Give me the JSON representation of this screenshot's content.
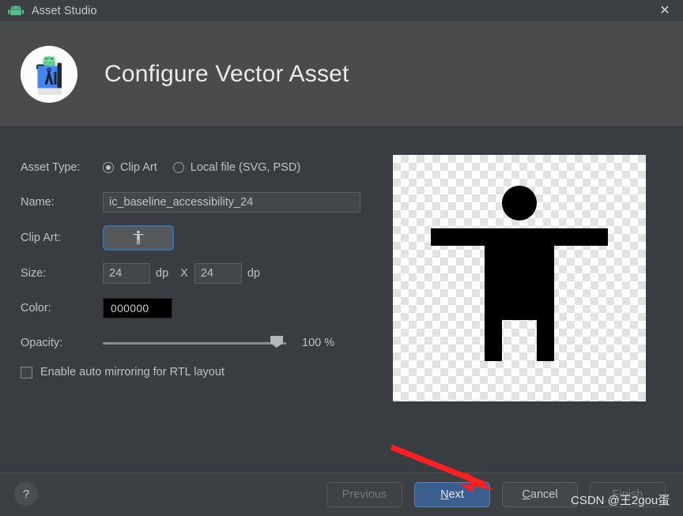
{
  "window": {
    "title": "Asset Studio",
    "app_icon": "android-robot-icon",
    "close_label": "✕"
  },
  "header": {
    "logo": "asset-studio-logo-icon",
    "title": "Configure Vector Asset"
  },
  "form": {
    "asset_type": {
      "label": "Asset Type:",
      "options": [
        {
          "label": "Clip Art",
          "selected": true
        },
        {
          "label": "Local file (SVG, PSD)",
          "selected": false
        }
      ]
    },
    "name": {
      "label": "Name:",
      "value": "ic_baseline_accessibility_24",
      "placeholder": ""
    },
    "clip_art": {
      "label": "Clip Art:",
      "icon": "accessibility-icon"
    },
    "size": {
      "label": "Size:",
      "width": "24",
      "height": "24",
      "unit": "dp",
      "separator": "X"
    },
    "color": {
      "label": "Color:",
      "value": "000000",
      "hex": "#000000"
    },
    "opacity": {
      "label": "Opacity:",
      "value": 100,
      "display": "100 %"
    },
    "rtl": {
      "label": "Enable auto mirroring for RTL layout",
      "checked": false
    }
  },
  "preview": {
    "name": "vector-preview",
    "icon": "accessibility-icon",
    "fill": "#000000"
  },
  "footer": {
    "help_label": "?",
    "buttons": [
      {
        "name": "previous",
        "label": "Previous",
        "state": "disabled",
        "mnemonic": ""
      },
      {
        "name": "next",
        "label": "Next",
        "state": "primary",
        "mnemonic": "N"
      },
      {
        "name": "cancel",
        "label": "Cancel",
        "state": "normal",
        "mnemonic": "C"
      },
      {
        "name": "finish",
        "label": "Finish",
        "state": "disabled",
        "mnemonic": "F"
      }
    ]
  },
  "annotations": {
    "arrow_color": "#fb1f1f",
    "watermark": "CSDN @王2gou蛋"
  },
  "colors": {
    "titlebar_bg": "#3c4043",
    "header_bg": "#4a4b4d",
    "body_bg": "#393d41",
    "accent_blue": "#3a6fa8",
    "primary_button": "#3a5f8f"
  }
}
